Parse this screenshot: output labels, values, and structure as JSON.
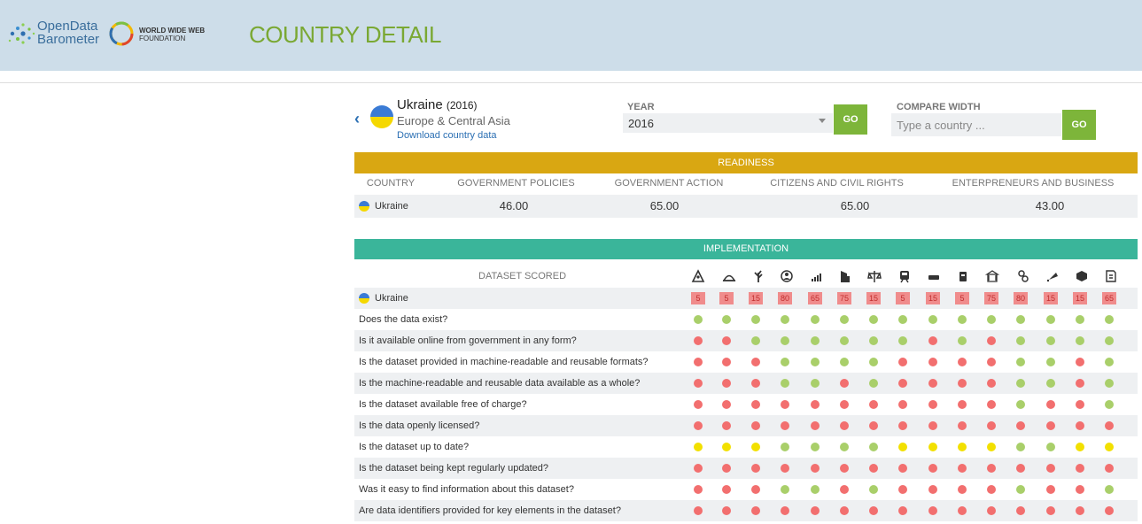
{
  "header": {
    "logo_line1": "OpenData",
    "logo_line2": "Barometer",
    "w3f_line1": "WORLD WIDE WEB",
    "w3f_line2": "FOUNDATION",
    "title": "COUNTRY DETAIL"
  },
  "country": {
    "name": "Ukraine",
    "year_tag": "(2016)",
    "region": "Europe & Central Asia",
    "download_label": "Download country data"
  },
  "controls": {
    "year_label": "YEAR",
    "year_value": "2016",
    "go_label": "GO",
    "compare_label": "COMPARE WIDTH",
    "compare_placeholder": "Type a country ..."
  },
  "readiness": {
    "title": "READINESS",
    "columns": [
      "COUNTRY",
      "GOVERNMENT POLICIES",
      "GOVERNMENT ACTION",
      "CITIZENS AND CIVIL RIGHTS",
      "ENTERPRENEURS AND BUSINESS"
    ],
    "row": {
      "country": "Ukraine",
      "values": [
        "46.00",
        "65.00",
        "65.00",
        "43.00"
      ]
    }
  },
  "implementation": {
    "title": "IMPLEMENTATION",
    "dataset_header": "DATASET SCORED",
    "icons": [
      "map-icon",
      "land-icon",
      "agriculture-icon",
      "census-icon",
      "statistics-icon",
      "company-icon",
      "legislation-icon",
      "transport-icon",
      "budget-icon",
      "spending-icon",
      "government-icon",
      "education-icon",
      "health-icon",
      "crime-icon",
      "environment-icon",
      "contracts-icon"
    ],
    "score_row": {
      "country": "Ukraine",
      "scores": [
        "5",
        "5",
        "15",
        "80",
        "65",
        "75",
        "15",
        "5",
        "15",
        "5",
        "75",
        "80",
        "15",
        "15",
        "65"
      ]
    },
    "questions": [
      {
        "label": "Does the data exist?",
        "marks": "ggggggggggggggg"
      },
      {
        "label": "Is it available online from government in any form?",
        "marks": "rrggggggrgrgggg"
      },
      {
        "label": "Is the dataset provided in machine-readable and reusable formats?",
        "marks": "rrrggggrrrrggrg"
      },
      {
        "label": "Is the machine-readable and reusable data available as a whole?",
        "marks": "rrrggrgrrrrggrg"
      },
      {
        "label": "Is the dataset available free of charge?",
        "marks": "rrrrrrrrrrrgrrg"
      },
      {
        "label": "Is the data openly licensed?",
        "marks": "rrrrrrrrrrrrrrr"
      },
      {
        "label": "Is the dataset up to date?",
        "marks": "yyyggggyyyyggyyr"
      },
      {
        "label": "Is the dataset being kept regularly updated?",
        "marks": "rrrrrrrrrrrrrrr"
      },
      {
        "label": "Was it easy to find information about this dataset?",
        "marks": "rrrggrgrrrrgrrg"
      },
      {
        "label": "Are data identifiers provided for key elements in the dataset?",
        "marks": "rrrrrrrrrrrrrrr"
      }
    ]
  },
  "colors": {
    "header_bg": "#cddde9",
    "title_green": "#7aa833",
    "readiness": "#d9a712",
    "implementation": "#3ab59a",
    "go_button": "#7db53a",
    "yes": "#a9cf6a",
    "no": "#f26f6f",
    "partial": "#f2e000"
  }
}
